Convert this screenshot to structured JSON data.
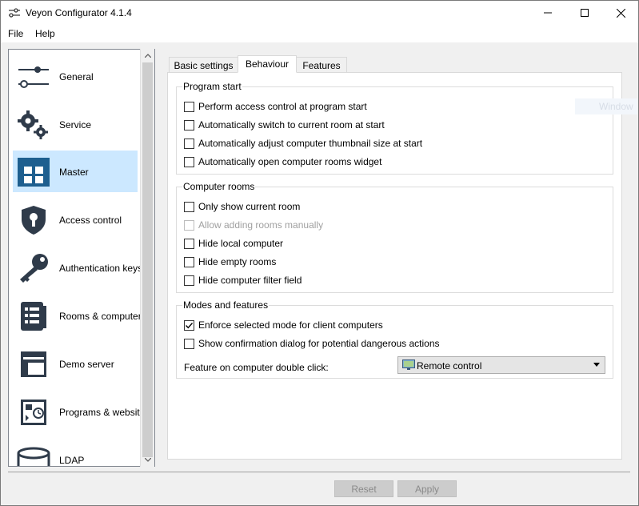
{
  "window": {
    "title": "Veyon Configurator 4.1.4",
    "controls": {
      "minimize": "minimize",
      "maximize": "maximize",
      "close": "close"
    }
  },
  "menu": {
    "items": [
      "File",
      "Help"
    ]
  },
  "sidebar": {
    "items": [
      {
        "label": "General",
        "icon": "sliders-icon",
        "selected": false
      },
      {
        "label": "Service",
        "icon": "gears-icon",
        "selected": false
      },
      {
        "label": "Master",
        "icon": "grid-icon",
        "selected": true
      },
      {
        "label": "Access control",
        "icon": "shield-lock-icon",
        "selected": false
      },
      {
        "label": "Authentication keys",
        "icon": "key-icon",
        "selected": false
      },
      {
        "label": "Rooms & computers",
        "icon": "list-icon",
        "selected": false
      },
      {
        "label": "Demo server",
        "icon": "window-icon",
        "selected": false
      },
      {
        "label": "Programs & websites",
        "icon": "programs-clock-icon",
        "selected": false
      },
      {
        "label": "LDAP",
        "icon": "database-icon",
        "selected": false
      }
    ]
  },
  "tabs": [
    {
      "label": "Basic settings",
      "active": false
    },
    {
      "label": "Behaviour",
      "active": true
    },
    {
      "label": "Features",
      "active": false
    }
  ],
  "groups": {
    "program_start": {
      "title": "Program start",
      "options": [
        {
          "label": "Perform access control at program start",
          "checked": false,
          "enabled": true
        },
        {
          "label": "Automatically switch to current room at start",
          "checked": false,
          "enabled": true
        },
        {
          "label": "Automatically adjust computer thumbnail size at start",
          "checked": false,
          "enabled": true
        },
        {
          "label": "Automatically open computer rooms widget",
          "checked": false,
          "enabled": true
        }
      ]
    },
    "computer_rooms": {
      "title": "Computer rooms",
      "options": [
        {
          "label": "Only show current room",
          "checked": false,
          "enabled": true
        },
        {
          "label": "Allow adding rooms manually",
          "checked": false,
          "enabled": false
        },
        {
          "label": "Hide local computer",
          "checked": false,
          "enabled": true
        },
        {
          "label": "Hide empty rooms",
          "checked": false,
          "enabled": true
        },
        {
          "label": "Hide computer filter field",
          "checked": false,
          "enabled": true
        }
      ]
    },
    "modes_features": {
      "title": "Modes and features",
      "options": [
        {
          "label": "Enforce selected mode for client computers",
          "checked": true,
          "enabled": true
        },
        {
          "label": "Show confirmation dialog for potential dangerous actions",
          "checked": false,
          "enabled": true
        }
      ],
      "double_click": {
        "label": "Feature on computer double click:",
        "value": "Remote control",
        "icon": "remote-control-icon"
      }
    }
  },
  "ghost_overlay": {
    "label": "Window"
  },
  "footer": {
    "reset_label": "Reset",
    "apply_label": "Apply"
  },
  "colors": {
    "selection": "#cce8ff",
    "icon_dark": "#2f3b4a",
    "accent_blue": "#1e5f8f"
  }
}
